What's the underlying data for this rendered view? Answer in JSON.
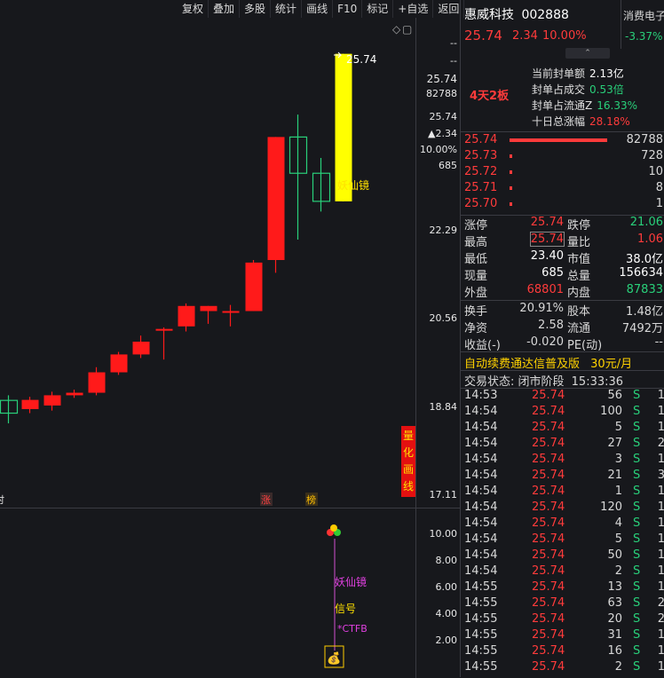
{
  "toolbar": [
    "复权",
    "叠加",
    "多股",
    "统计",
    "画线",
    "F10",
    "标记",
    "+自选",
    "返回"
  ],
  "chart": {
    "price_labels": [
      "25.74",
      "22.29",
      "20.56",
      "18.84",
      "17.11"
    ],
    "right_top": {
      "dash1": "--",
      "dash2": "--",
      "price": "25.74",
      "vol": "82788",
      "price_red": "25.74",
      "change": "▲2.34",
      "pct": "10.00%",
      "cur": "685"
    },
    "peak_label": "25.74",
    "annotation": "妖仙镜",
    "badge_chars": [
      "量",
      "化",
      "画",
      "线"
    ],
    "marker_zhang": "涨",
    "marker_bang": "榜",
    "marker_left": "时",
    "diamond": "◇",
    "box_icon": "▢",
    "colors": {
      "up": "#ff1a1a",
      "down": "#29d07a",
      "highlight": "#ffff00",
      "bg": "#17181c"
    }
  },
  "chart_data": {
    "type": "candlestick",
    "series": [
      {
        "name": "daily",
        "ohlc": [
          [
            18.95,
            18.7,
            19.05,
            18.5
          ],
          [
            18.78,
            18.96,
            19.02,
            18.7
          ],
          [
            18.85,
            19.05,
            19.12,
            18.75
          ],
          [
            19.05,
            19.1,
            19.16,
            19.0
          ],
          [
            19.1,
            19.5,
            19.6,
            19.05
          ],
          [
            19.5,
            19.85,
            19.9,
            19.45
          ],
          [
            19.85,
            20.1,
            20.22,
            19.78
          ],
          [
            20.35,
            20.35,
            20.38,
            19.75
          ],
          [
            20.4,
            20.8,
            20.85,
            20.3
          ],
          [
            20.7,
            20.8,
            20.8,
            20.45
          ],
          [
            20.7,
            20.7,
            20.82,
            20.4
          ],
          [
            20.7,
            21.65,
            21.7,
            20.7
          ],
          [
            21.7,
            24.11,
            24.11,
            21.45
          ],
          [
            24.11,
            23.4,
            24.55,
            22.1
          ],
          [
            23.4,
            22.85,
            23.7,
            22.65
          ],
          [
            22.85,
            25.74,
            25.74,
            22.85
          ]
        ]
      }
    ],
    "ylim": [
      17.11,
      26.5
    ]
  },
  "indicator": {
    "ticks": [
      "10.00",
      "8.00",
      "6.00",
      "4.00",
      "2.00"
    ],
    "label1": "妖仙镜",
    "label2": "信号",
    "label3": "*CTFB",
    "money_icon": "💰"
  },
  "panel": {
    "name": "惠威科技",
    "code": "002888",
    "price": "25.74",
    "change": "2.34",
    "pct": "10.00%",
    "sector": "消费电子",
    "sector_pct": "-3.37%",
    "streak": "4天2板",
    "seal": [
      {
        "k": "当前封单额",
        "v": "2.13亿",
        "c": "white"
      },
      {
        "k": "封单占成交",
        "v": "0.53倍",
        "c": "green"
      },
      {
        "k": "封单占流通Z",
        "v": "16.33%",
        "c": "green"
      },
      {
        "k": "十日总涨幅",
        "v": "28.18%",
        "c": "red"
      }
    ],
    "book": [
      {
        "p": "25.74",
        "v": "82788"
      },
      {
        "p": "25.73",
        "v": "728"
      },
      {
        "p": "25.72",
        "v": "10"
      },
      {
        "p": "25.71",
        "v": "8"
      },
      {
        "p": "25.70",
        "v": "1"
      }
    ],
    "stats": [
      [
        "涨停",
        "25.74",
        "red",
        "跌停",
        "21.06",
        "green"
      ],
      [
        "最高",
        "25.74",
        "red",
        "量比",
        "1.06",
        "red"
      ],
      [
        "最低",
        "23.40",
        "white",
        "市值",
        "38.0亿",
        "white"
      ],
      [
        "现量",
        "685",
        "white",
        "总量",
        "156634",
        "white"
      ],
      [
        "外盘",
        "68801",
        "red",
        "内盘",
        "87833",
        "green"
      ]
    ],
    "stats2": [
      [
        "换手",
        "20.91%",
        "股本",
        "1.48亿"
      ],
      [
        "净资",
        "2.58",
        "流通",
        "7492万"
      ],
      [
        "收益(-)",
        "-0.020",
        "PE(动)",
        "--"
      ]
    ],
    "promo": "自动续费通达信普及版",
    "promo_price": "30元/月",
    "status_label": "交易状态: 闭市阶段",
    "status_time": "15:33:36",
    "ticks": [
      [
        "14:53",
        "25.74",
        "56",
        "S"
      ],
      [
        "14:54",
        "25.74",
        "100",
        "S"
      ],
      [
        "14:54",
        "25.74",
        "5",
        "S"
      ],
      [
        "14:54",
        "25.74",
        "27",
        "S"
      ],
      [
        "14:54",
        "25.74",
        "3",
        "S"
      ],
      [
        "14:54",
        "25.74",
        "21",
        "S"
      ],
      [
        "14:54",
        "25.74",
        "1",
        "S"
      ],
      [
        "14:54",
        "25.74",
        "120",
        "S"
      ],
      [
        "14:54",
        "25.74",
        "4",
        "S"
      ],
      [
        "14:54",
        "25.74",
        "5",
        "S"
      ],
      [
        "14:54",
        "25.74",
        "50",
        "S"
      ],
      [
        "14:54",
        "25.74",
        "2",
        "S"
      ],
      [
        "14:55",
        "25.74",
        "13",
        "S"
      ],
      [
        "14:55",
        "25.74",
        "63",
        "S"
      ],
      [
        "14:55",
        "25.74",
        "20",
        "S"
      ],
      [
        "14:55",
        "25.74",
        "31",
        "S"
      ],
      [
        "14:55",
        "25.74",
        "16",
        "S"
      ],
      [
        "14:55",
        "25.74",
        "2",
        "S"
      ]
    ],
    "tick_tail": [
      "1",
      "1",
      "1",
      "2",
      "1",
      "3",
      "1",
      "1",
      "1",
      "1",
      "1",
      "1",
      "1",
      "2",
      "2",
      "1",
      "1",
      "1"
    ]
  }
}
